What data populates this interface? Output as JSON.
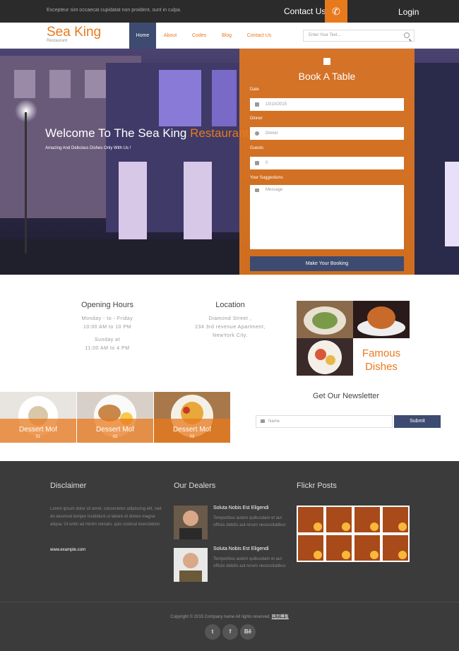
{
  "topbar": {
    "tagline": "Excepteur sint occaecat cupidatat non proident, sunt in culpa.",
    "contact_label": "Contact Us",
    "login_label": "Login"
  },
  "brand": {
    "name": "Sea King",
    "sub": "Restaurant"
  },
  "nav": {
    "items": [
      {
        "label": "Home",
        "active": true
      },
      {
        "label": "About",
        "active": false
      },
      {
        "label": "Codes",
        "active": false
      },
      {
        "label": "Blog",
        "active": false
      },
      {
        "label": "Contact Us",
        "active": false
      }
    ],
    "search_placeholder": "Enter Your Text..."
  },
  "hero": {
    "title_main": "Welcome To The Sea King",
    "title_accent": "Restaurant",
    "subtitle": "Amazing And Delicious Dishes Only With Us !"
  },
  "booking": {
    "title": "Book A Table",
    "date_label": "Date",
    "date_value": "10/10/2015",
    "dinner_label": "Dinner",
    "dinner_value": "Dinner",
    "guests_label": "Guests",
    "guests_value": "0",
    "suggestions_label": "Your Suggestions",
    "message_placeholder": "Message",
    "submit_label": "Make Your Booking"
  },
  "info": {
    "opening": {
      "title": "Opening Hours",
      "line1": "Monday - to - Friday",
      "line2": "10:00 AM to 10 PM",
      "line3": "Sunday at",
      "line4": "11:00 AM to 4 PM"
    },
    "location": {
      "title": "Location",
      "line1": "Diamond Street ,",
      "line2": "234 3rd revenue Apartment,",
      "line3": "NewYork City."
    },
    "famous_line1": "Famous",
    "famous_line2": "Dishes"
  },
  "desserts": [
    {
      "title": "Dessert Mof",
      "num": "01"
    },
    {
      "title": "Dessert Mof",
      "num": "02"
    },
    {
      "title": "Dessert Mof",
      "num": "03"
    }
  ],
  "newsletter": {
    "title": "Get Our Newsletter",
    "placeholder": "Name",
    "submit_label": "Submit"
  },
  "footer": {
    "disclaimer_title": "Disclaimer",
    "disclaimer_text": "Lorem ipsum dolor sit amet, consectetur adipiscing elit, sed do eiusmod tempor incididunt ut labore et dolore magna aliqua. Ut enim ad minim veniam, quis nostrud exercitation",
    "disclaimer_link": "www.example.com",
    "dealers_title": "Our Dealers",
    "dealers": [
      {
        "name": "Soluta Nobis Est Eligendi",
        "text": "Temporibus autem quibusdam et aut officiis debitis aut rerum necessitatibus"
      },
      {
        "name": "Soluta Nobis Est Eligendi",
        "text": "Temporibus autem quibusdam et aut officiis debitis aut rerum necessitatibus"
      }
    ],
    "flickr_title": "Flickr Posts",
    "copyright": "Copyright © 2015 Company name All rights reserved.",
    "copyright_link": "网页模板",
    "social": [
      "twitter-icon",
      "facebook-icon",
      "behance-icon"
    ]
  },
  "colors": {
    "accent": "#e87a1e",
    "navy": "#3d4b70",
    "dark": "#2b2b2b",
    "footer": "#3b3b3b"
  }
}
